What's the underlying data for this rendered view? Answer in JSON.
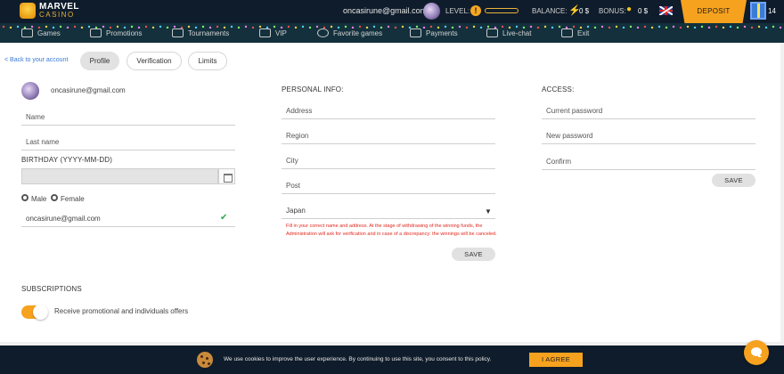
{
  "header": {
    "logo_top": "MARVEL",
    "logo_bottom": "CASINO",
    "user_email": "oncasirune@gmail.com",
    "level_label": "LEVEL:",
    "level_badge": "!",
    "balance_label": "BALANCE:",
    "balance_value": "0 $",
    "bonus_label": "BONUS:",
    "bonus_value": "0 $",
    "deposit_label": "DEPOSIT",
    "gift_count": "14",
    "language_icon": "uk-flag-icon"
  },
  "nav": {
    "items": [
      {
        "label": "Games",
        "icon": "gamepad-icon"
      },
      {
        "label": "Promotions",
        "icon": "megaphone-icon"
      },
      {
        "label": "Tournaments",
        "icon": "trophy-icon"
      },
      {
        "label": "VIP",
        "icon": "diamond-icon"
      },
      {
        "label": "Favorite games",
        "icon": "heart-icon"
      },
      {
        "label": "Payments",
        "icon": "wallet-icon"
      },
      {
        "label": "Live-chat",
        "icon": "chat-icon"
      },
      {
        "label": "Exit",
        "icon": "exit-icon"
      }
    ]
  },
  "account": {
    "back_link": "< Back to your account",
    "tabs": [
      {
        "label": "Profile",
        "active": true
      },
      {
        "label": "Verification",
        "active": false
      },
      {
        "label": "Limits",
        "active": false
      }
    ]
  },
  "profile": {
    "email": "oncasirune@gmail.com",
    "name_label": "Name",
    "last_name_label": "Last name",
    "birthday_title": "BIRTHDAY (YYYY-MM-DD)",
    "gender_male": "Male",
    "gender_female": "Female",
    "email_field_value": "oncasirune@gmail.com"
  },
  "personal_info": {
    "title": "PERSONAL INFO:",
    "address_label": "Address",
    "region_label": "Region",
    "city_label": "City",
    "post_label": "Post",
    "country_value": "Japan",
    "warning": "Fill in your correct name and address. At the stage of withdrawing of the winning funds, the Administration will ask for verification and in case of a discrepancy: the winnings will be canceled.",
    "save_label": "SAVE"
  },
  "access": {
    "title": "ACCESS:",
    "current_password_label": "Current password",
    "new_password_label": "New password",
    "confirm_label": "Confirm",
    "save_label": "SAVE"
  },
  "subscriptions": {
    "title": "SUBSCRIPTIONS",
    "toggle_label": "Receive promotional and individuals offers",
    "toggle_on": true
  },
  "cookie": {
    "text": "We use cookies to improve the user experience. By continuing to use this site, you consent to this policy.",
    "agree_label": "I AGREE"
  },
  "colors": {
    "header_bg": "#0f1c2b",
    "nav_bg": "#13303c",
    "accent": "#f7a21e",
    "link": "#3a7bd5",
    "warning": "#e0281e"
  }
}
